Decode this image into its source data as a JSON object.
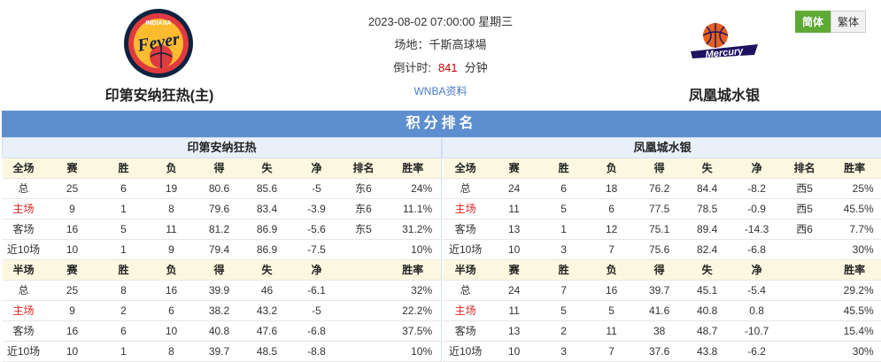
{
  "home": {
    "name": "印第安纳狂热(主)",
    "logo_top": "INDIANA",
    "logo_word": "Fever"
  },
  "away": {
    "name": "凤凰城水银",
    "logo_word": "Mercury"
  },
  "match": {
    "datetime": "2023-08-02 07:00:00 星期三",
    "venue": "场地：千斯高球場",
    "countdown_label": "倒计时:",
    "countdown_value": "841",
    "countdown_unit": "分钟",
    "link": "WNBA资料"
  },
  "lang": {
    "simplified": "简体",
    "traditional": "繁体"
  },
  "standings": {
    "title": "积分排名",
    "left_team": "印第安纳狂热",
    "right_team": "凤凰城水银",
    "full_headers": [
      "全场",
      "赛",
      "胜",
      "负",
      "得",
      "失",
      "净",
      "排名",
      "胜率"
    ],
    "half_headers": [
      "半场",
      "赛",
      "胜",
      "负",
      "得",
      "失",
      "净",
      "",
      "胜率"
    ],
    "left_full": [
      [
        "总",
        "25",
        "6",
        "19",
        "80.6",
        "85.6",
        "-5",
        "东6",
        "24%"
      ],
      [
        "主场",
        "9",
        "1",
        "8",
        "79.6",
        "83.4",
        "-3.9",
        "东6",
        "11.1%"
      ],
      [
        "客场",
        "16",
        "5",
        "11",
        "81.2",
        "86.9",
        "-5.6",
        "东5",
        "31.2%"
      ],
      [
        "近10场",
        "10",
        "1",
        "9",
        "79.4",
        "86.9",
        "-7.5",
        "",
        "10%"
      ]
    ],
    "left_half": [
      [
        "总",
        "25",
        "8",
        "16",
        "39.9",
        "46",
        "-6.1",
        "",
        "32%"
      ],
      [
        "主场",
        "9",
        "2",
        "6",
        "38.2",
        "43.2",
        "-5",
        "",
        "22.2%"
      ],
      [
        "客场",
        "16",
        "6",
        "10",
        "40.8",
        "47.6",
        "-6.8",
        "",
        "37.5%"
      ],
      [
        "近10场",
        "10",
        "1",
        "8",
        "39.7",
        "48.5",
        "-8.8",
        "",
        "10%"
      ]
    ],
    "right_full": [
      [
        "总",
        "24",
        "6",
        "18",
        "76.2",
        "84.4",
        "-8.2",
        "西5",
        "25%"
      ],
      [
        "主场",
        "11",
        "5",
        "6",
        "77.5",
        "78.5",
        "-0.9",
        "西5",
        "45.5%"
      ],
      [
        "客场",
        "13",
        "1",
        "12",
        "75.1",
        "89.4",
        "-14.3",
        "西6",
        "7.7%"
      ],
      [
        "近10场",
        "10",
        "3",
        "7",
        "75.6",
        "82.4",
        "-6.8",
        "",
        "30%"
      ]
    ],
    "right_half": [
      [
        "总",
        "24",
        "7",
        "16",
        "39.7",
        "45.1",
        "-5.4",
        "",
        "29.2%"
      ],
      [
        "主场",
        "11",
        "5",
        "5",
        "41.6",
        "40.8",
        "0.8",
        "",
        "45.5%"
      ],
      [
        "客场",
        "13",
        "2",
        "11",
        "38",
        "48.7",
        "-10.7",
        "",
        "15.4%"
      ],
      [
        "近10场",
        "10",
        "3",
        "7",
        "37.6",
        "43.8",
        "-6.2",
        "",
        "30%"
      ]
    ]
  }
}
